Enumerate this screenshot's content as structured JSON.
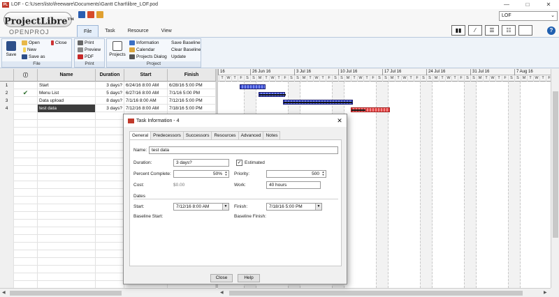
{
  "window": {
    "title": "LOF - C:\\Users\\lsto\\freeware\\Documents\\Gantt Chart\\libre_LOF.pod",
    "minimize": "—",
    "maximize": "□",
    "close": "✕"
  },
  "logo": {
    "main": "ProjectLibre",
    "tm": "TM",
    "sub": "OPENPROJ"
  },
  "ribbon_tabs": [
    "File",
    "Task",
    "Resource",
    "View"
  ],
  "project_select": {
    "value": "LOF"
  },
  "help": "?",
  "ribbon": {
    "file_group": {
      "label": "File",
      "save": "Save",
      "open": "Open",
      "close": "Close",
      "new": "New",
      "save_as": "Save as"
    },
    "print_group": {
      "label": "Print",
      "print": "Print",
      "preview": "Preview",
      "pdf": "PDF"
    },
    "project_group": {
      "label": "Project",
      "projects": "Projects",
      "information": "Information",
      "calendar": "Calendar",
      "projects_dialog": "Projects Dialog",
      "save_baseline": "Save Baseline",
      "clear_baseline": "Clear Baseline",
      "update": "Update"
    }
  },
  "table": {
    "columns": [
      "Name",
      "Duration",
      "Start",
      "Finish"
    ],
    "rows": [
      {
        "num": "1",
        "check": "",
        "name": "Start",
        "duration": "3 days?",
        "start": "6/24/16 8:00 AM",
        "finish": "6/28/16 5:00 PM"
      },
      {
        "num": "2",
        "check": "✔",
        "name": "Menu List",
        "duration": "5 days?",
        "start": "6/27/16 8:00 AM",
        "finish": "7/1/16 5:00 PM"
      },
      {
        "num": "3",
        "check": "",
        "name": "Data upload",
        "duration": "8 days?",
        "start": "7/1/16 8:00 AM",
        "finish": "7/12/16 5:00 PM"
      },
      {
        "num": "4",
        "check": "",
        "name": "test data",
        "duration": "3 days?",
        "start": "7/12/16 8:00 AM",
        "finish": "7/18/16 5:00 PM"
      }
    ]
  },
  "gantt": {
    "weeks": [
      "16",
      "26 Jun 16",
      "3 Jul 16",
      "10 Jul 16",
      "17 Jul 16",
      "24 Jul 16",
      "31 Jul 16",
      "7 Aug 16"
    ],
    "day_letters": [
      "T",
      "W",
      "T",
      "F",
      "S",
      "S",
      "M"
    ]
  },
  "dialog": {
    "title": "Task Information - 4",
    "tabs": [
      "General",
      "Predecessors",
      "Successors",
      "Resources",
      "Advanced",
      "Notes"
    ],
    "name_label": "Name:",
    "name_value": "test data",
    "duration_label": "Duration:",
    "duration_value": "3 days?",
    "estimated_label": "Estimated",
    "estimated_checked": "✓",
    "percent_label": "Percent Complete:",
    "percent_value": "50%",
    "priority_label": "Priority:",
    "priority_value": "500",
    "cost_label": "Cost:",
    "cost_value": "$0.00",
    "work_label": "Work:",
    "work_value": "40 hours",
    "dates_label": "Dates",
    "start_label": "Start:",
    "start_value": "7/12/16 8:00 AM",
    "finish_label": "Finish:",
    "finish_value": "7/18/16 5:00 PM",
    "baseline_start_label": "Baseline Start:",
    "baseline_finish_label": "Baseline Finish:",
    "close_button": "Close",
    "help_button": "Help"
  }
}
